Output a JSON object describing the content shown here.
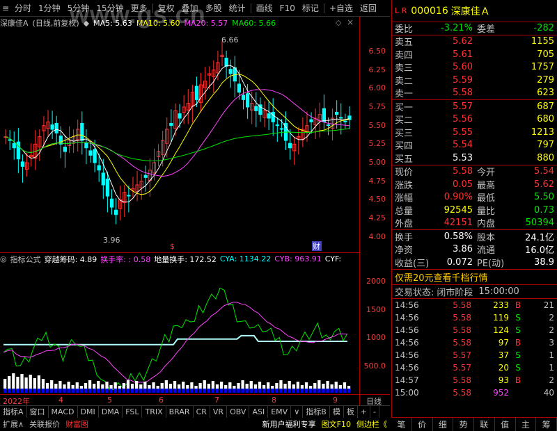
{
  "toolbar": {
    "items": [
      "分时",
      "1分钟",
      "5分钟",
      "15分钟",
      "更多",
      "复权",
      "叠加",
      "多股",
      "统计",
      "画线",
      "F10",
      "标记",
      "+自选",
      "返回"
    ]
  },
  "watermark": "www.gs.cn",
  "chart_title": {
    "name": "深康佳A",
    "mode": "(日线,前复权)",
    "ma5": "MA5: 5.63",
    "ma10": "MA10: 5.60",
    "ma20": "MA20: 5.57",
    "ma60": "MA60: 5.66"
  },
  "annotations": {
    "high": "6.66",
    "low": "3.96",
    "marker_s": "$",
    "marker_cai": "财"
  },
  "price_axis": [
    "6.50",
    "6.25",
    "6.00",
    "5.75",
    "5.50",
    "5.25",
    "5.00",
    "4.75",
    "4.50",
    "4.25",
    "4.00"
  ],
  "indicator_bar": {
    "name": "指标公式",
    "chuanyue": "穿越筹码: 4.89",
    "huanshoulv": "换手率: : 0.58",
    "dilianghuanshou": "地量换手: 172.52",
    "cya": "CYA: 1134.22",
    "cyb": "CYB: 963.91",
    "cyf": "CYF:"
  },
  "indicator_axis": [
    "2000",
    "1500",
    "1000",
    "500.0"
  ],
  "dates": {
    "year": "2022年",
    "m4": "4",
    "m5": "5",
    "m6": "6",
    "m7": "7",
    "m8": "8",
    "m9": "9",
    "period": "日线"
  },
  "tabs": [
    "指标A",
    "窗口",
    "MACD",
    "DMI",
    "DMA",
    "FSL",
    "TRIX",
    "BRAR",
    "CR",
    "VR",
    "OBV",
    "ASI",
    "EMV",
    "∨",
    "指标B",
    "模",
    "板",
    "+",
    "-"
  ],
  "bottom_bar": {
    "kuozhan": "扩展∧",
    "guanlian": "关联报价",
    "caifutu": "财富图",
    "promo": "新用户福利专享",
    "tuwen": "图文F10",
    "cebian": "侧边栏《"
  },
  "stock": {
    "lr": "L R",
    "code": "000016",
    "name": "深康佳Ａ"
  },
  "weibi": {
    "label1": "委比",
    "v1": "-3.21%",
    "label2": "委差",
    "v2": "-282"
  },
  "asks": [
    {
      "label": "卖五",
      "price": "5.62",
      "vol": "1155"
    },
    {
      "label": "卖四",
      "price": "5.61",
      "vol": "705"
    },
    {
      "label": "卖三",
      "price": "5.60",
      "vol": "1757"
    },
    {
      "label": "卖二",
      "price": "5.59",
      "vol": "279"
    },
    {
      "label": "卖一",
      "price": "5.58",
      "vol": "623"
    }
  ],
  "bids": [
    {
      "label": "买一",
      "price": "5.57",
      "vol": "687"
    },
    {
      "label": "买二",
      "price": "5.56",
      "vol": "680"
    },
    {
      "label": "买三",
      "price": "5.55",
      "vol": "1213"
    },
    {
      "label": "买四",
      "price": "5.54",
      "vol": "797"
    },
    {
      "label": "买五",
      "price": "5.53",
      "vol": "880"
    }
  ],
  "quote": [
    {
      "l1": "现价",
      "v1": "5.58",
      "l2": "今开",
      "v2": "5.54"
    },
    {
      "l1": "涨跌",
      "v1": "0.05",
      "l2": "最高",
      "v2": "5.62"
    },
    {
      "l1": "涨幅",
      "v1": "0.90%",
      "l2": "最低",
      "v2": "5.50"
    },
    {
      "l1": "总量",
      "v1": "92545",
      "l2": "量比",
      "v2": "0.73"
    },
    {
      "l1": "外盘",
      "v1": "42151",
      "l2": "内盘",
      "v2": "50394"
    }
  ],
  "fund": [
    {
      "l1": "换手",
      "v1": "0.58%",
      "l2": "股本",
      "v2": "24.1亿"
    },
    {
      "l1": "净资",
      "v1": "3.86",
      "l2": "流通",
      "v2": "16.0亿"
    },
    {
      "l1": "收益(三)",
      "v1": "0.072",
      "l2": "PE(动)",
      "v2": "38.9"
    }
  ],
  "promo_line": "仅需20元查看千档行情",
  "trade_status": {
    "label": "交易状态:",
    "value": "闭市阶段",
    "time": "15:00:00"
  },
  "trades": [
    {
      "time": "14:56",
      "price": "5.58",
      "vol": "233",
      "bs": "B",
      "cnt": "21"
    },
    {
      "time": "14:56",
      "price": "5.58",
      "vol": "119",
      "bs": "S",
      "cnt": "2"
    },
    {
      "time": "14:56",
      "price": "5.58",
      "vol": "124",
      "bs": "S",
      "cnt": "2"
    },
    {
      "time": "14:56",
      "price": "5.58",
      "vol": "97",
      "bs": "B",
      "cnt": "3"
    },
    {
      "time": "14:56",
      "price": "5.57",
      "vol": "37",
      "bs": "S",
      "cnt": "1"
    },
    {
      "time": "14:56",
      "price": "5.57",
      "vol": "20",
      "bs": "S",
      "cnt": "1"
    },
    {
      "time": "14:57",
      "price": "5.58",
      "vol": "93",
      "bs": "B",
      "cnt": "2"
    },
    {
      "time": "15:00",
      "price": "5.58",
      "vol": "952",
      "bs": "",
      "cnt": "40"
    }
  ],
  "side_icons": [
    "笔",
    "价",
    "细",
    "势",
    "联",
    "值",
    "主",
    "筹"
  ],
  "colors": {
    "up": "#ff3232",
    "down": "#00e600",
    "ma5": "#ffffff",
    "ma10": "#ffff00",
    "ma20": "#ff44ff",
    "ma60": "#00e600",
    "bg": "#000000"
  }
}
